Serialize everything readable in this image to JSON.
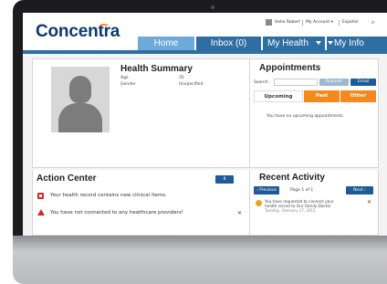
{
  "header": {
    "logo": "Concentra",
    "user_name": "Hello Robert",
    "my_account": "My Account ▾",
    "language": "Español"
  },
  "nav": {
    "tabs": [
      {
        "label": "Home",
        "active": true
      },
      {
        "label": "Inbox (0)",
        "active": false
      },
      {
        "label": "My Health",
        "active": false,
        "dropdown": true
      },
      {
        "label": "My Info",
        "active": false,
        "dropdown": true
      }
    ]
  },
  "health_summary": {
    "title": "Health Summary",
    "age_label": "Age",
    "age_value": "35",
    "gender_label": "Gender",
    "gender_value": "Unspecified"
  },
  "appointments": {
    "title": "Appointments",
    "search_label": "Search:",
    "search_value": "",
    "request_label": "Request",
    "email_label": "Email",
    "tabs": [
      "Upcoming",
      "Past",
      "Other"
    ],
    "empty_message": "You have no upcoming appointments."
  },
  "action_center": {
    "title": "Action Center",
    "badge": "8",
    "items": [
      {
        "text": "Your health record contains new clinical items."
      },
      {
        "text": "You have not connected to any healthcare providers!"
      }
    ]
  },
  "recent_activity": {
    "title": "Recent Activity",
    "prev_label": "Previous",
    "page_text": "Page 1 of 1",
    "next_label": "Next",
    "items": [
      {
        "line1": "You have requested to connect your",
        "line2": "health record to Our Family Doctor",
        "date": "Tuesday, February 17, 2015"
      }
    ]
  },
  "colors": {
    "brand_navy": "#0d3b6e",
    "nav_blue": "#2f6ea3",
    "nav_active": "#6da9d9",
    "orange": "#f48a1e",
    "alert_red": "#d12a2a"
  }
}
